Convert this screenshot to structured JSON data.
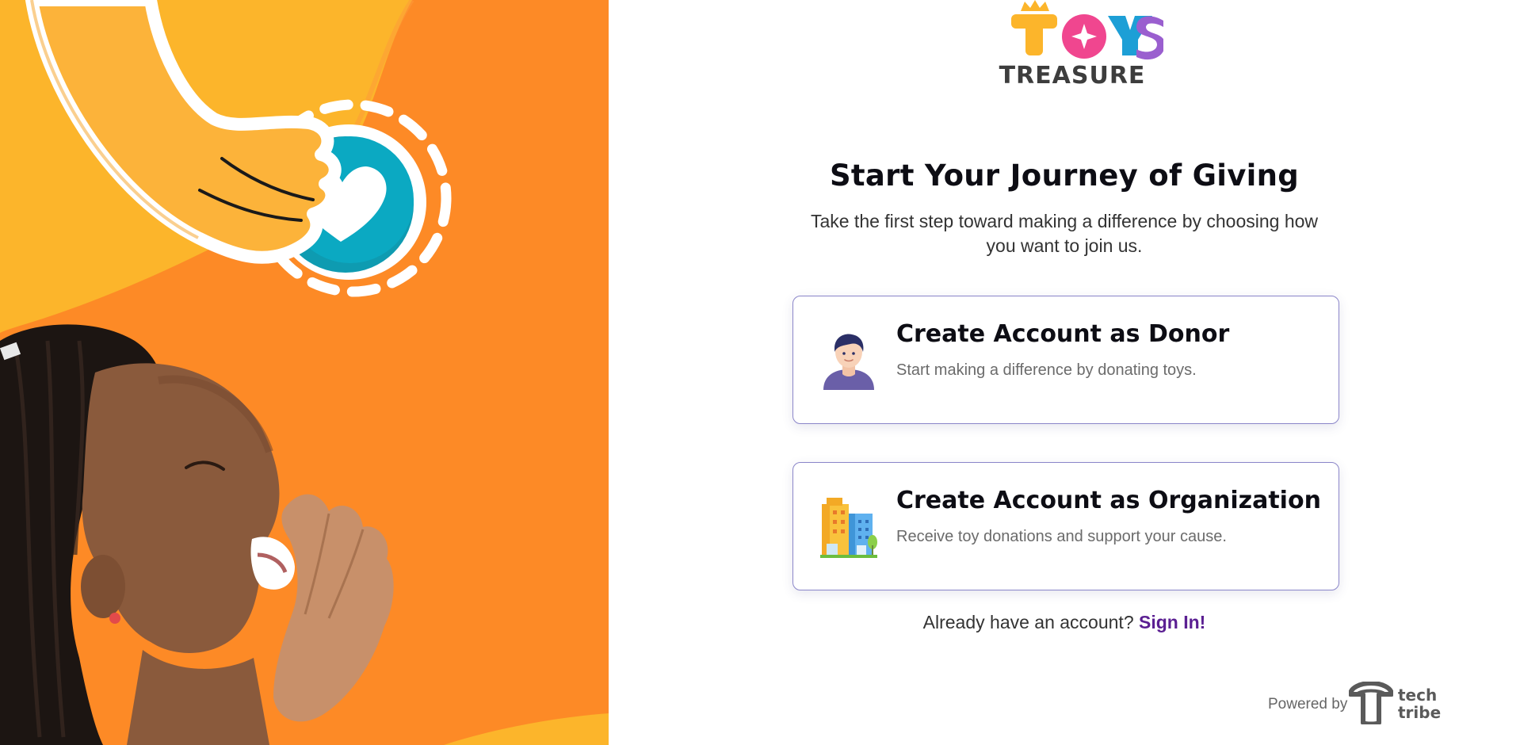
{
  "brand": {
    "logo_word": "TOYS",
    "logo_sub": "TREASURE",
    "colors": {
      "yellow": "#fcb52b",
      "pink": "#f0468f",
      "blue": "#1d9fd6",
      "purple": "#9a5fcf",
      "dark": "#3d3d3d"
    }
  },
  "hero": {
    "image": "girl-shouting-with-heart-coin-illustration",
    "colors": {
      "orange": "#fd8a26",
      "yellow": "#fcb52b",
      "teal": "#0ba9c2"
    }
  },
  "header": {
    "title": "Start Your Journey of Giving",
    "subtitle": "Take the first step toward making a difference by choosing how you want to join us."
  },
  "options": [
    {
      "title": "Create Account as Donor",
      "description": "Start making a difference by donating toys.",
      "icon": "person-avatar-icon"
    },
    {
      "title": "Create Account as Organization",
      "description": "Receive toy donations and support your cause.",
      "icon": "building-icon"
    }
  ],
  "signin": {
    "prompt": "Already have an account?",
    "link_label": "Sign In!",
    "link_color": "#5b1f92"
  },
  "footer": {
    "powered_by": "Powered by",
    "company_line1": "tech",
    "company_line2": "tribe"
  }
}
